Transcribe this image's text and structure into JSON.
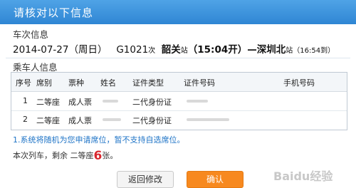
{
  "dialog": {
    "title": "请核对以下信息"
  },
  "train": {
    "section_label": "车次信息",
    "date": "2014-07-27",
    "weekday": "（周日）",
    "train_no": "G1021",
    "train_suffix": "次",
    "from_station": "韶关",
    "from_suffix": "站",
    "depart": "（15:04开）",
    "arrow": "—",
    "to_station": "深圳北",
    "to_suffix": "站",
    "arrive": "（16:54到）"
  },
  "passengers": {
    "section_label": "乘车人信息",
    "headers": [
      "序号",
      "席别",
      "票种",
      "姓名",
      "证件类型",
      "证件号码",
      "手机号码"
    ],
    "rows": [
      {
        "index": "1",
        "seat": "二等座",
        "ticket": "成人票",
        "name": "",
        "id_type": "二代身份证",
        "id_no": "",
        "phone": ""
      },
      {
        "index": "2",
        "seat": "二等座",
        "ticket": "成人票",
        "name": "",
        "id_type": "二代身份证",
        "id_no": "",
        "phone": ""
      }
    ]
  },
  "note": "1.系统将随机为您申请席位，暂不支持自选席位。",
  "remaining": {
    "prefix": "本次列车，剩余 二等座",
    "count": "6",
    "suffix": "张。"
  },
  "buttons": {
    "back": "返回修改",
    "confirm": "确认"
  },
  "watermark": "Baidu经验",
  "colors": {
    "title_bar": "#3b8fdb",
    "note": "#1f74c7",
    "count": "#d9272e",
    "confirm": "#f7891f"
  }
}
